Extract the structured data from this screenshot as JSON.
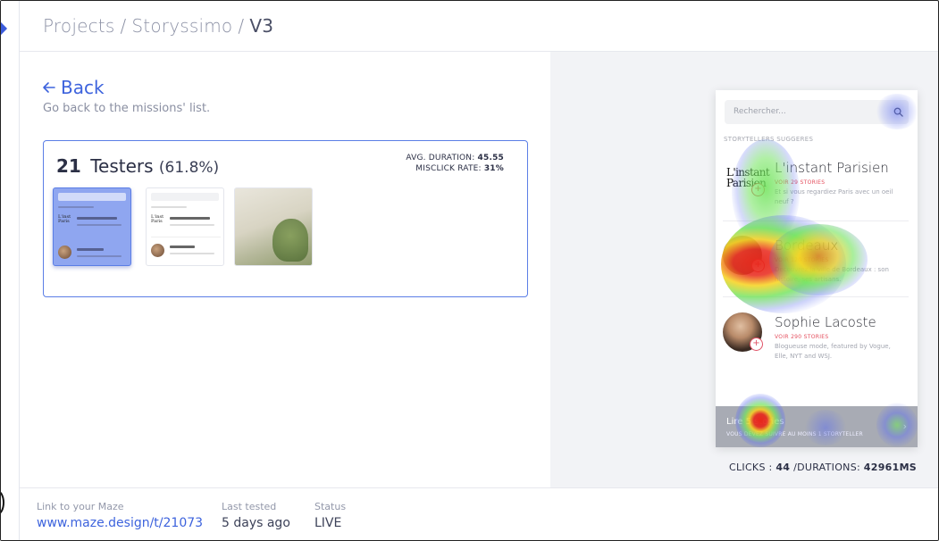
{
  "breadcrumb": {
    "projects": "Projects",
    "project": "Storyssimo",
    "version": "V3",
    "separator": "/"
  },
  "back": {
    "label": "Back",
    "subtitle": "Go back to the missions' list."
  },
  "testers": {
    "count": "21",
    "label": "Testers",
    "percent": "(61.8%)",
    "avg_duration_label": "AVG. DURATION:",
    "avg_duration_value": "45.55",
    "misclick_label": "MISCLICK RATE:",
    "misclick_value": "31%"
  },
  "thumbnails": [
    {
      "name": "screen-1",
      "selected": true
    },
    {
      "name": "screen-2",
      "selected": false
    },
    {
      "name": "screen-3",
      "selected": false
    }
  ],
  "phone": {
    "search_placeholder": "Rechercher...",
    "section_title": "STORYTELLERS SUGGERES",
    "items": [
      {
        "logo": "L'instant\nParisien",
        "name": "L'instant Parisien",
        "stories": "VOIR 29 STORIES",
        "desc": "Et si vous regardiez Paris avec un oeil neuf ?"
      },
      {
        "name": "Bordeaux",
        "stories": "VOIR 120 STORIES",
        "desc": "Decouvrez la ville de Bordeaux : son histoire, ses artisans."
      },
      {
        "name": "Sophie Lacoste",
        "stories": "VOIR 290 STORIES",
        "desc": "Blogueuse mode, featured by Vogue, Elle, NYT and WSJ."
      }
    ],
    "bottom_title": "Lire 5 stories",
    "bottom_sub": "VOUS DEVEZ SUIVRE AU MOINS 1 STORYTELLER"
  },
  "heatmap_stats": {
    "clicks_label": "CLICKS :",
    "clicks_value": "44",
    "durations_label": "/DURATIONS:",
    "durations_value": "42961MS"
  },
  "footer": {
    "link_label": "Link to your Maze",
    "link_value": "www.maze.design/t/21073",
    "tested_label": "Last tested",
    "tested_value": "5 days ago",
    "status_label": "Status",
    "status_value": "LIVE"
  },
  "colors": {
    "accent": "#3d63dd",
    "heat_hot": "#e8261a",
    "heat_warm": "#f7d21c",
    "heat_mid": "#6fe35a",
    "heat_cool": "#5c6ef0"
  }
}
